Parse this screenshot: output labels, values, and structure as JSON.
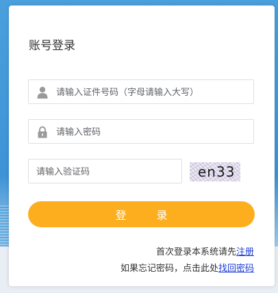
{
  "login": {
    "title": "账号登录",
    "username_placeholder": "请输入证件号码（字母请输入大写）",
    "password_placeholder": "请输入密码",
    "code_placeholder": "请输入验证码",
    "captcha_text": "en33",
    "submit_label": "登　录",
    "register_prefix": "首次登录本系统请先",
    "register_link": "注册",
    "forgot_prefix": "如果忘记密码，点击此处",
    "forgot_link": "找回密码"
  },
  "colors": {
    "accent": "#fdae1f",
    "background": "#4aa0dc",
    "link": "#1a3bd6"
  },
  "icons": [
    "user-icon",
    "lock-icon"
  ]
}
